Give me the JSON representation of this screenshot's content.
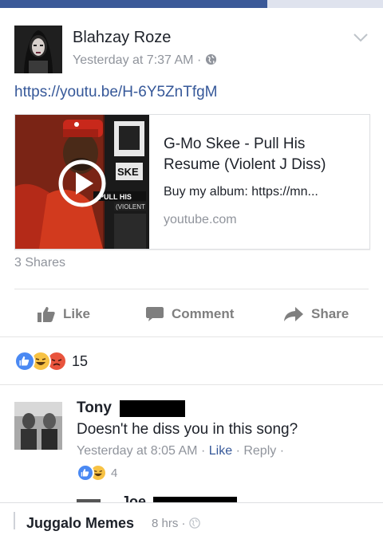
{
  "post": {
    "author": "Blahzay Roze",
    "timestamp": "Yesterday at 7:37 AM",
    "meta_separator": "·",
    "audience_icon": "globe-icon",
    "link_text": "https://youtu.be/H-6Y5ZnTfgM",
    "menu_icon": "chevron-down-icon"
  },
  "link_preview": {
    "title": "G-Mo Skee - Pull His Resume (Violent J Diss)",
    "description": "Buy my album: https://mn...",
    "domain": "youtube.com",
    "thumbnail_text": [
      "PULL HIS",
      "VIOLENT"
    ],
    "play_icon": "play-icon"
  },
  "stats": {
    "shares": "3 Shares"
  },
  "actions": [
    {
      "label": "Like",
      "icon": "thumbs-up-icon"
    },
    {
      "label": "Comment",
      "icon": "comment-icon"
    },
    {
      "label": "Share",
      "icon": "share-arrow-icon"
    }
  ],
  "reactions": {
    "count": "15",
    "types": [
      "like",
      "haha",
      "angry"
    ],
    "colors": {
      "like": "#4a89f3",
      "haha": "#f7c244",
      "angry": "#e9543d"
    }
  },
  "comment": {
    "name": "Tony",
    "text": "Doesn't he diss you in this song?",
    "timestamp": "Yesterday at 8:05 AM",
    "sep": "·",
    "like_label": "Like",
    "reply_label": "Reply",
    "reaction_count": "4"
  },
  "reply_preview": {
    "name": "Joe"
  },
  "footer": {
    "page_name": "Juggalo Memes",
    "time": "8 hrs",
    "sep": "·",
    "audience_icon": "globe-icon"
  },
  "colors": {
    "link": "#365899",
    "meta": "#90949c",
    "facebook_blue": "#3b5998"
  }
}
